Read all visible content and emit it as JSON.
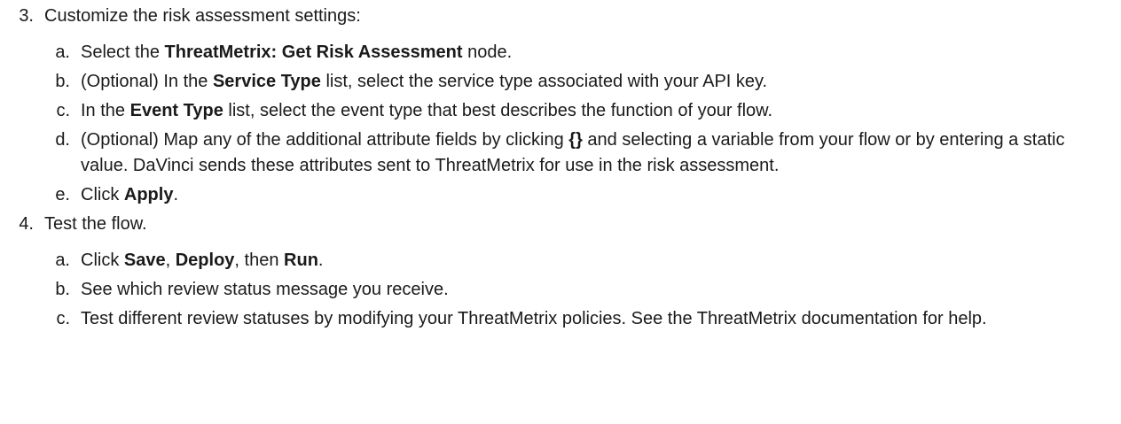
{
  "steps": [
    {
      "num": "3.",
      "text": "Customize the risk assessment settings:",
      "substeps": [
        {
          "letter": "a.",
          "parts": [
            "Select the ",
            "ThreatMetrix: Get Risk Assessment",
            " node."
          ]
        },
        {
          "letter": "b.",
          "parts": [
            "(Optional) In the ",
            "Service Type",
            " list, select the service type associated with your API key."
          ]
        },
        {
          "letter": "c.",
          "parts": [
            "In the ",
            "Event Type",
            " list, select the event type that best describes the function of your flow."
          ]
        },
        {
          "letter": "d.",
          "parts": [
            "(Optional) Map any of the additional attribute fields by clicking ",
            "{}",
            " and selecting a variable from your flow or by entering a static value. DaVinci sends these attributes sent to ThreatMetrix for use in the risk assessment."
          ]
        },
        {
          "letter": "e.",
          "parts": [
            "Click ",
            "Apply",
            "."
          ]
        }
      ]
    },
    {
      "num": "4.",
      "text": "Test the flow.",
      "substeps": [
        {
          "letter": "a.",
          "parts": [
            "Click ",
            "Save",
            ", ",
            "Deploy",
            ", then ",
            "Run",
            "."
          ]
        },
        {
          "letter": "b.",
          "parts": [
            "See which review status message you receive."
          ]
        },
        {
          "letter": "c.",
          "parts": [
            "Test different review statuses by modifying your ThreatMetrix policies. See the ThreatMetrix documentation for help."
          ]
        }
      ]
    }
  ]
}
